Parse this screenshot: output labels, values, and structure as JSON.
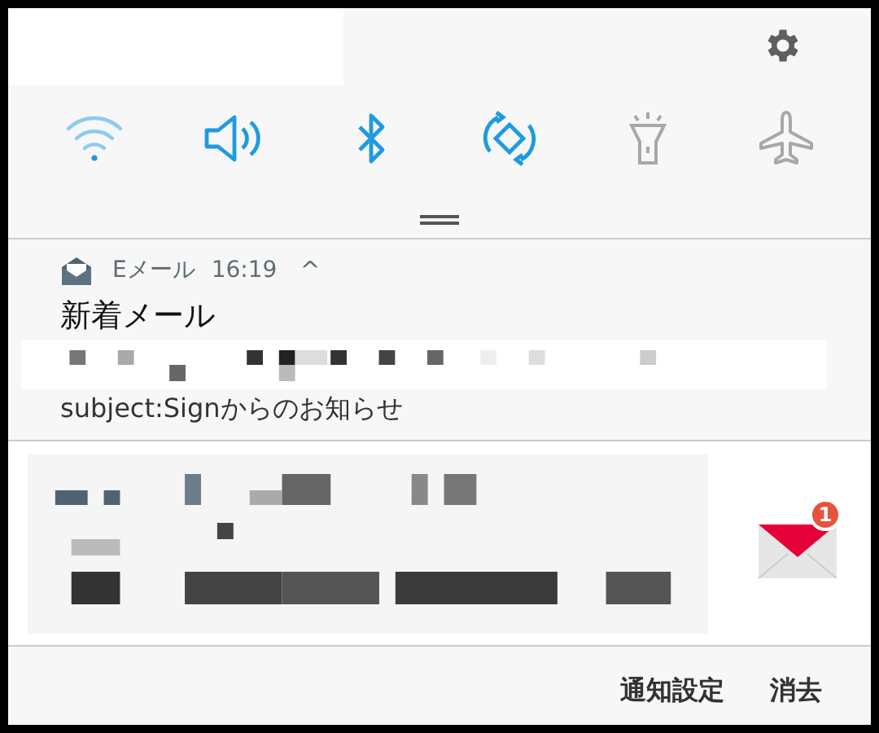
{
  "quick_settings": [
    {
      "kind": "wifi",
      "on": true
    },
    {
      "kind": "sound",
      "on": true
    },
    {
      "kind": "bluetooth",
      "on": true
    },
    {
      "kind": "rotate",
      "on": true
    },
    {
      "kind": "flashlight",
      "on": false
    },
    {
      "kind": "airplane",
      "on": false
    }
  ],
  "notification": {
    "app": "Eメール",
    "time": "16:19",
    "expand_icon": "^",
    "title": "新着メール",
    "subject": "subject:Signからのお知らせ"
  },
  "message": {
    "badge": "1"
  },
  "actions": [
    "通知設定",
    "消去"
  ]
}
